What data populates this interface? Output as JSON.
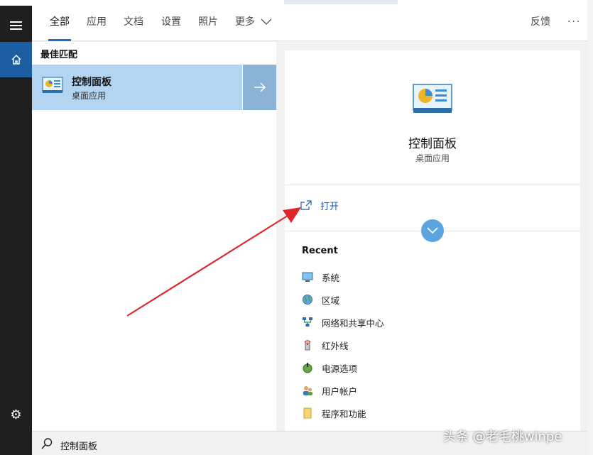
{
  "tabs": [
    {
      "label": "全部",
      "active": true
    },
    {
      "label": "应用"
    },
    {
      "label": "文档"
    },
    {
      "label": "设置"
    },
    {
      "label": "照片"
    },
    {
      "label": "更多"
    }
  ],
  "header": {
    "feedback_label": "反馈",
    "more_options": "···"
  },
  "results": {
    "section_label": "最佳匹配",
    "best": {
      "title": "控制面板",
      "subtitle": "桌面应用",
      "icon": "control-panel-icon"
    }
  },
  "detail": {
    "title": "控制面板",
    "subtitle": "桌面应用",
    "open_label": "打开",
    "recent_header": "Recent",
    "recent": [
      {
        "label": "系统",
        "icon": "system-icon"
      },
      {
        "label": "区域",
        "icon": "region-icon"
      },
      {
        "label": "网络和共享中心",
        "icon": "network-icon"
      },
      {
        "label": "红外线",
        "icon": "infrared-icon"
      },
      {
        "label": "电源选项",
        "icon": "power-icon"
      },
      {
        "label": "用户帐户",
        "icon": "users-icon"
      },
      {
        "label": "程序和功能",
        "icon": "programs-icon"
      }
    ]
  },
  "search": {
    "query": "控制面板"
  },
  "watermark": "头条 @老毛桃winpe",
  "colors": {
    "accent": "#1f6cc4",
    "selection": "#b4d5f1",
    "rail": "#1f1f1f",
    "annotation": "#e0262b"
  }
}
